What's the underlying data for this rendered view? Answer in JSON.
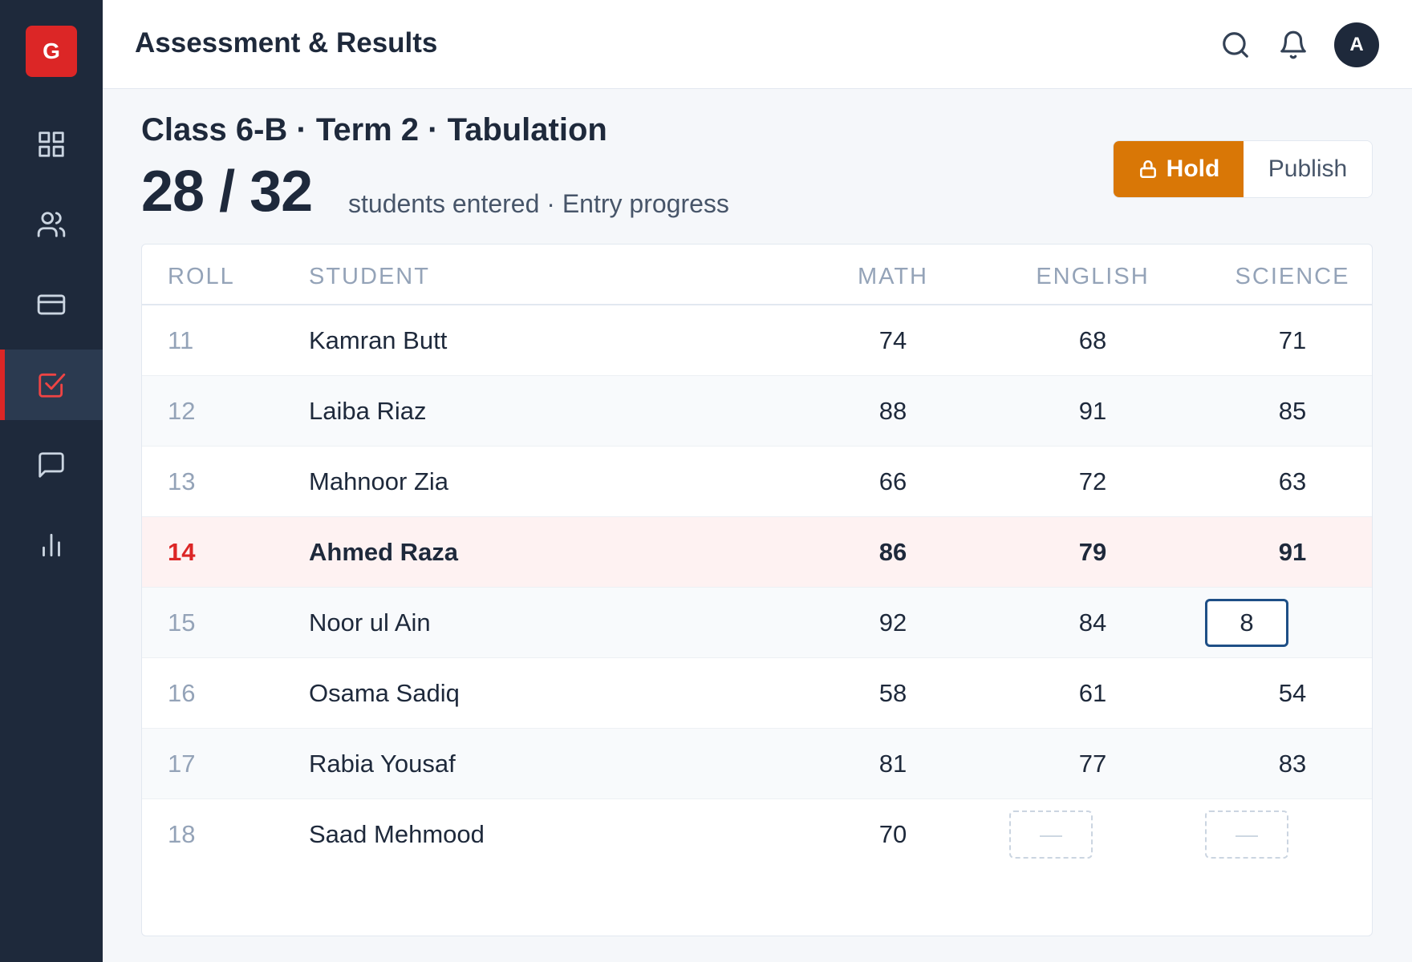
{
  "sidebar": {
    "logo_letter": "G",
    "items": [
      {
        "name": "dashboard",
        "icon": "grid-icon",
        "active": false
      },
      {
        "name": "students",
        "icon": "users-icon",
        "active": false
      },
      {
        "name": "fees",
        "icon": "credit-card-icon",
        "active": false
      },
      {
        "name": "assessment",
        "icon": "checkbox-icon",
        "active": true
      },
      {
        "name": "messages",
        "icon": "chat-icon",
        "active": false
      },
      {
        "name": "reports",
        "icon": "bar-chart-icon",
        "active": false
      }
    ]
  },
  "header": {
    "title": "Assessment & Results",
    "avatar_initial": "A"
  },
  "page": {
    "title": "Class 6-B · Term 2 · Tabulation",
    "entered": "28 / 32",
    "caption": "students entered · Entry progress"
  },
  "actions": {
    "hold_label": "Hold",
    "publish_label": "Publish",
    "selected": "Hold"
  },
  "table": {
    "columns": [
      "ROLL",
      "STUDENT",
      "MATH",
      "ENGLISH",
      "SCIENCE"
    ],
    "rows": [
      {
        "roll": "11",
        "student": "Kamran Butt",
        "math": "74",
        "english": "68",
        "science": "71"
      },
      {
        "roll": "12",
        "student": "Laiba Riaz",
        "math": "88",
        "english": "91",
        "science": "85"
      },
      {
        "roll": "13",
        "student": "Mahnoor Zia",
        "math": "66",
        "english": "72",
        "science": "63"
      },
      {
        "roll": "14",
        "student": "Ahmed Raza",
        "math": "86",
        "english": "79",
        "science": "91"
      },
      {
        "roll": "15",
        "student": "Noor ul Ain",
        "math": "92",
        "english": "84",
        "science": "8"
      },
      {
        "roll": "16",
        "student": "Osama Sadiq",
        "math": "58",
        "english": "61",
        "science": "54"
      },
      {
        "roll": "17",
        "student": "Rabia Yousaf",
        "math": "81",
        "english": "77",
        "science": "83"
      },
      {
        "roll": "18",
        "student": "Saad Mehmood",
        "math": "70",
        "english": "—",
        "science": "—"
      }
    ]
  },
  "colors": {
    "sidebar_bg": "#1e293b",
    "accent_red": "#dc2626",
    "hold_orange": "#d97706",
    "focus_blue": "#1e4f86"
  }
}
